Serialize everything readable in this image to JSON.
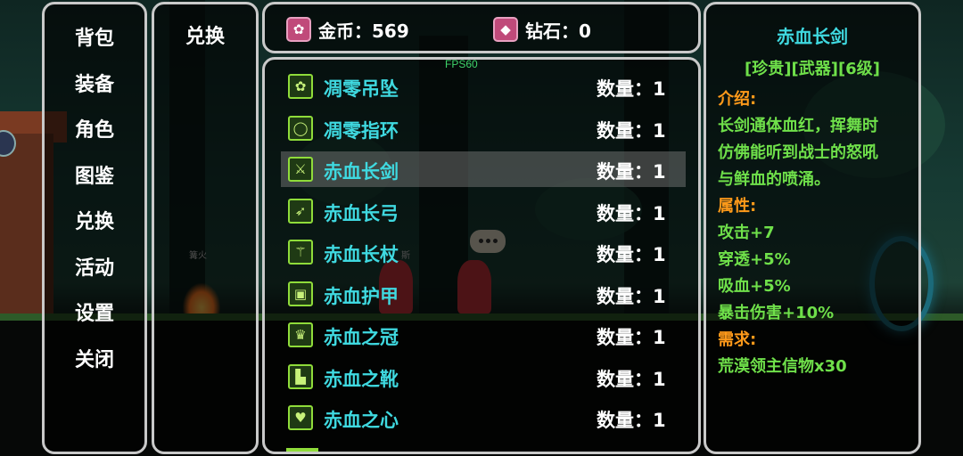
{
  "scene": {
    "fps": "FPS60",
    "label_campfire": "篝火",
    "label_npc": "斯"
  },
  "menu": {
    "items": [
      "背包",
      "装备",
      "角色",
      "图鉴",
      "兑换",
      "活动",
      "设置",
      "关闭"
    ]
  },
  "tabs": {
    "active": "兑换"
  },
  "currency": {
    "gold_label": "金币：569",
    "diamond_label": "钻石：0"
  },
  "items": [
    {
      "name": "凋零吊坠",
      "qty": "数量：1",
      "icon": "pendant-icon",
      "glyph": "✿"
    },
    {
      "name": "凋零指环",
      "qty": "数量：1",
      "icon": "ring-icon",
      "glyph": "◯"
    },
    {
      "name": "赤血长剑",
      "qty": "数量：1",
      "icon": "sword-icon",
      "glyph": "⚔",
      "selected": true
    },
    {
      "name": "赤血长弓",
      "qty": "数量：1",
      "icon": "bow-icon",
      "glyph": "➶"
    },
    {
      "name": "赤血长杖",
      "qty": "数量：1",
      "icon": "staff-icon",
      "glyph": "⚚"
    },
    {
      "name": "赤血护甲",
      "qty": "数量：1",
      "icon": "armor-icon",
      "glyph": "▣"
    },
    {
      "name": "赤血之冠",
      "qty": "数量：1",
      "icon": "crown-icon",
      "glyph": "♛"
    },
    {
      "name": "赤血之靴",
      "qty": "数量：1",
      "icon": "boots-icon",
      "glyph": "▙"
    },
    {
      "name": "赤血之心",
      "qty": "数量：1",
      "icon": "heart-icon",
      "glyph": "♥"
    }
  ],
  "detail": {
    "title": "赤血长剑",
    "tags": "[珍贵][武器][6级]",
    "intro_label": "介绍:",
    "intro_lines": [
      "长剑通体血红，挥舞时",
      "仿佛能听到战士的怒吼",
      "与鲜血的喷涌。"
    ],
    "attr_label": "属性:",
    "attrs": [
      "攻击+7",
      "穿透+5%",
      "吸血+5%",
      "暴击伤害+10%"
    ],
    "req_label": "需求:",
    "reqs": [
      "荒漠领主信物x30"
    ]
  },
  "colors": {
    "item_name": "#3fd9e0",
    "label_orange": "#ff9a1a",
    "text_green": "#6fe04a",
    "panel_border": "#c9c9c9"
  }
}
